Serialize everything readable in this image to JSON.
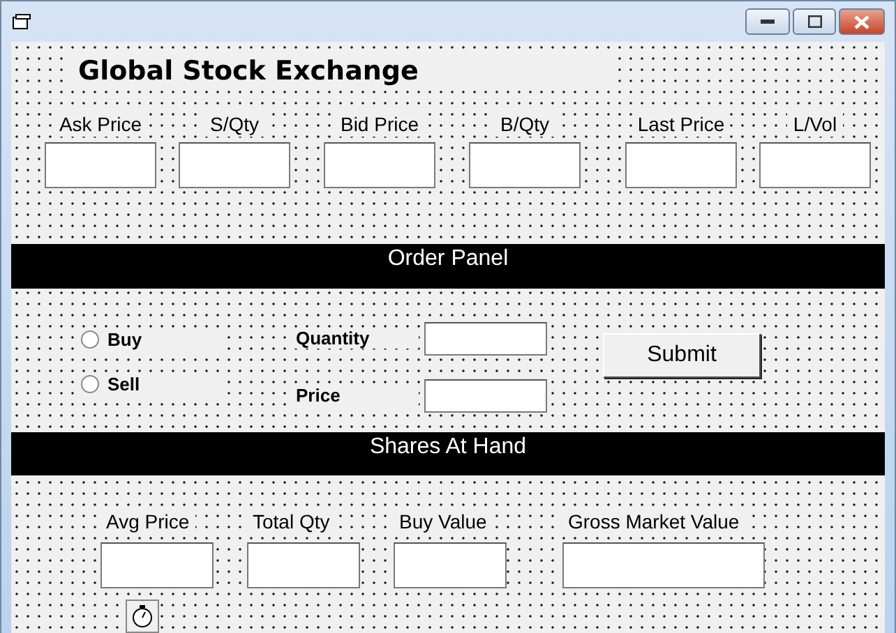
{
  "heading": "Global Stock Exchange",
  "quotes": [
    {
      "label": "Ask Price"
    },
    {
      "label": "S/Qty"
    },
    {
      "label": "Bid Price"
    },
    {
      "label": "B/Qty"
    },
    {
      "label": "Last Price"
    },
    {
      "label": "L/Vol"
    }
  ],
  "order_panel": {
    "title": "Order Panel",
    "sides": [
      {
        "label": "Buy",
        "selected": false
      },
      {
        "label": "Sell",
        "selected": false
      }
    ],
    "fields": [
      {
        "label": "Quantity"
      },
      {
        "label": "Price"
      }
    ],
    "submit": "Submit"
  },
  "shares_panel": {
    "title": "Shares At Hand",
    "fields": [
      {
        "label": "Avg Price",
        "wide": false
      },
      {
        "label": "Total Qty",
        "wide": false
      },
      {
        "label": "Buy Value",
        "wide": false
      },
      {
        "label": "Gross Market Value",
        "wide": true
      }
    ]
  }
}
